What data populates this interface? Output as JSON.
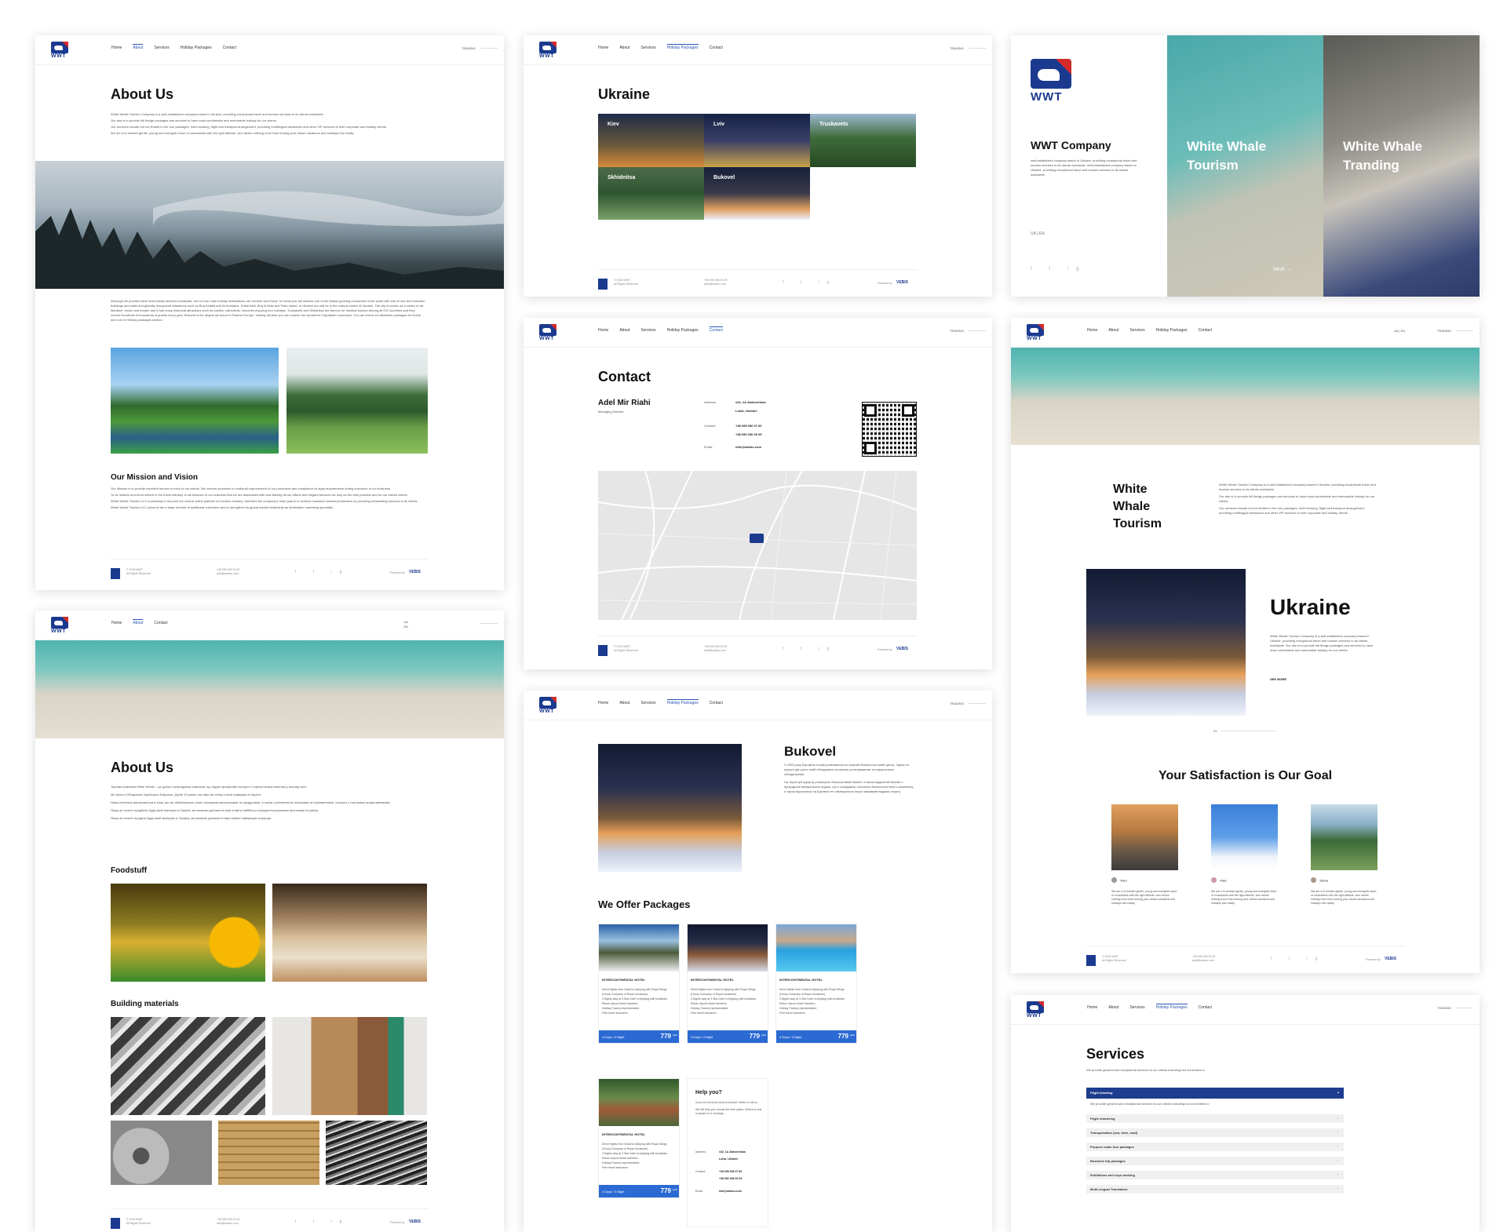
{
  "brand": {
    "logo_text": "WWT"
  },
  "nav": {
    "home": "Home",
    "about": "About",
    "services": "Services",
    "holiday": "Holiday Packages",
    "contact": "Contact",
    "right": "TRADING",
    "lang_ua": "UA",
    "lang_en": "EN",
    "lang_pair": "UA  |  EN"
  },
  "about": {
    "title": "About Us",
    "p1": "White Whale Tourism Company is a well-established company based in Ukraine, providing exceptional travel and tourism services to its clients worldwide.",
    "p2": "Our aim is to provide full fledge packages and services to have most comfortable and memorable holiday for our clients.",
    "p3": "Our services include but not limited to the tour packages, hotel booking, flight and transport arrangement, providing multilingual translators and other VIP services to both corporate and holiday clients.",
    "p4": "We are a hi-minded gentle, young and energetic team of consultants with the right attitude, who desire nothing more than turning your dream vacations and holidays into reality.",
    "body": "Although we provide travel and holiday services worldwide, but our two main holiday destinations are Ukraine and Dubai. In Dubai you will witness one of the fastest growing economies in the world with lots of new and beautiful buildings and malls and globally recognized attractions such as Burj Khalifa and its fountains, Dubai Mall, Burj Al Arab and Palm Island. In Ukraine you will be in the cultural centre of Ukraine. The city is known as a centre of art, literature, music and theatre and it has many historical attractions such as castles, cathedrals, churches enjoying tour holidays. Truskavets and Skhidnitsa are famous for medical tourism among all CIS countries and they receive hundreds of thousands of guests every year. Bukovel is the largest ski resort in Eastern Europe. Visiting Ukraine you can explore the wonderful Carpathian mountains. You can check our attractive packages for Dubai and Lviv in Holiday packages section.",
    "mission_title": "Our Mission and Vision",
    "m1": "Our Mission is to provide excellent service to each of our clients. We commit ourselves to continual improvement of our processes and compliance to legal requirements during execution of our business.",
    "m2": "To be leaders and trend setters in the travel industry. In all avenues of our business that we are associated with and utilizing all our efforts and elegant services we only do the best possible and for our valued clients.",
    "m3": "White Whale Tourism LLC is planning to become the central online platform for tourism industry; therefore the company's main goal is to achieve maximum market penetration by providing outstanding services to its clients.",
    "m4": "White Whale Tourism LLC plans to win a large number of additional customers and to strengthen its global market leadership as destination marketing specialist."
  },
  "footer": {
    "copy": "© 2016 WWT",
    "rights": "All Rights Reserved",
    "phone": "+38 050 036 00 09",
    "email": "adel@wwtou.com",
    "social": "f  t  ig",
    "powered": "Powered by",
    "powered_brand": "VEBIS"
  },
  "ukraine": {
    "title": "Ukraine",
    "cities": [
      "Kiev",
      "Lviv",
      "Truskavets",
      "Skhidnitsa",
      "Bukovel"
    ]
  },
  "landing": {
    "company": "WWT Company",
    "desc": "well-established company based in Ukraine, providing exceptional travel and tourism services to its clients worldwide. Well-established company based in Ukraine, providing exceptional travel and tourism services to its clients worldwide.",
    "panel1": "White Whale Tourism",
    "panel2": "White Whale Tranding",
    "next": "Next"
  },
  "contact": {
    "title": "Contact",
    "name": "Adel Mir Riahi",
    "role": "Managing Director",
    "address_label": "Address:",
    "address1": "#42, 1A Zadvoretska",
    "address2": "Lutsk, Ukraine",
    "contact_label": "Contact:",
    "phone1": "+38 095 006 07 60",
    "phone2": "+38 050 036 00 09",
    "email_label": "Email:",
    "email": "info@wwtou.com"
  },
  "tourism": {
    "title": "White Whale Tourism",
    "p1": "White Whale Tourism Company is a well-established company based in Ukraine, providing exceptional travel and tourism services to its clients worldwide.",
    "p2": "Our aim is to provide full fledge packages and services to have most comfortable and memorable holiday for our clients.",
    "p3": "Our services include but not limited to the tour packages, hotel booking, flight and transport arrangement, providing multilingual translators and other VIP services to both corporate and holiday clients.",
    "ukraine_title": "Ukraine",
    "ukraine_text": "White Whale Tourism Company is a well-established company based in Ukraine, providing exceptional travel and tourism services to its clients worldwide. Our aim is to provide full fledge packages and services to have most comfortable and memorable holiday for our clients.",
    "see_more": "SEE MORE",
    "pager": "01",
    "satisfaction": "Your Satisfaction is Our Goal",
    "reviews": [
      {
        "name": "Paul",
        "text": "We are a hi-minded gentle, young and energetic team of consultants with the right attitude, who desire nothing more than turning your dream vacations and holidays into reality."
      },
      {
        "name": "Kate",
        "text": "We are a hi-minded gentle, young and energetic team of consultants with the right attitude, who desire nothing more than turning your dream vacations and holidays into reality."
      },
      {
        "name": "Diana",
        "text": "We are a hi-minded gentle, young and energetic team of consultants with the right attitude, who desire nothing more than turning your dream vacations and holidays into reality."
      }
    ]
  },
  "trading": {
    "title": "About Us",
    "p1": "Торгова компанія White Whale – це добре налагоджена компанія, що надає професійні послуги з торгівлі всіма клієнтам у всьому світі.",
    "p2": "Ми були в Об'єднаних Арабських Еміратах, Дубаї 15 років і ось вже ми тепер стали гравцями в Україні.",
    "p3": "Наша політика заключається в тому, що ми обмінюємося лише хорошими матеріалами та продуктами, а також з упевненістю зв'язками та перевіреними, послуги з торговими представниками.",
    "p4": "Якщо ви хочете придбати будь-який матеріал в Україні, ми можемо допомогти вам знайти найбільш конкурентоспроможні пропозиції на ринку.",
    "p5": "Якщо ви хочете продати будь-який матеріал в Україну, ми можемо допомогти вам знайти найкращих покупців.",
    "food_title": "Foodstuff",
    "build_title": "Building materials"
  },
  "bukovel": {
    "title": "Bukovel",
    "p1": "З 2003 року Буковель почав розвиватися як лижний бальнеологічний центр. Зараз на курорті діє шість ліній обладнаних сучасним устаткуванням та першокласні обладнанням.",
    "p2": "На території курорту розміщено безкоштовний Бювет, а також відкритий басейн з природною мінеральною водою, що є складовою частиною бальнеологічного комплексу, а також відпочинок на Буковелі не обмежується лише зимовими видами спорту.",
    "offer_title": "We Offer Packages",
    "hotel": "INTERCONTINENTAL HOTEL",
    "d1": "Direct flights from Dubai to Arjeplog with Royal Wings (Group Company of Royal Jordanian)",
    "d2": "3 Nights stay at 3 Star hotel in Arjeplog with breakfast",
    "d3": "Return Airport-Hotel transfers",
    "d4": "Holiday Factory representative",
    "d5": "Free travel insurance",
    "length": "4 Days / 3 Night",
    "price": "779",
    "currency": "AED",
    "help_title": "Help you?",
    "help1": "If you do not know what to choose? Write or call us.",
    "help2": "We will help you choose the best option. Where to rest in peace or to recharge."
  },
  "services": {
    "title": "Services",
    "intro": "We provide general and exceptional services to our clients including but not limited to:",
    "open": "Flight ticketing",
    "open_text": "We provide general and exceptional services to our clients including but not limited to:",
    "items": [
      "Flight chartering",
      "Transportation (sea, train, road)",
      "Purpose made tour packages",
      "Business trip packages",
      "Exhibitions and expo booking",
      "Multi-Lingual Translators"
    ]
  },
  "colors": {
    "brand_blue": "#1b3a8f",
    "accent_red": "#d42a2a",
    "link_blue": "#2b6ad3",
    "accordion_blue": "#1e3d8f"
  }
}
